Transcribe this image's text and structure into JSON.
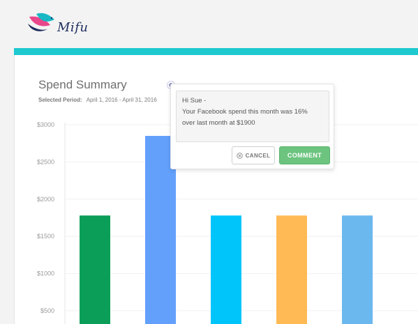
{
  "header": {
    "logo_text": "Mifu",
    "accent_color": "#1ec9cf"
  },
  "summary": {
    "title": "Spend Summary",
    "period_label": "Selected Period:",
    "period_value": "April 1, 2016 - April 31, 2016"
  },
  "chart_data": {
    "type": "bar",
    "categories": [
      "",
      "",
      "",
      "",
      ""
    ],
    "values": [
      1780,
      2850,
      1780,
      1780,
      1780
    ],
    "colors": [
      "#0a9e58",
      "#62a0fb",
      "#00c5fb",
      "#ffba55",
      "#6bb8ee"
    ],
    "yticks": [
      "$500",
      "$1000",
      "$1500",
      "$2000",
      "$2500",
      "$3000"
    ],
    "ytick_values": [
      500,
      1000,
      1500,
      2000,
      2500,
      3000
    ],
    "ylim": [
      0,
      3000
    ],
    "grid": true
  },
  "comment": {
    "lines": [
      "Hi Sue -",
      "Your Facebook spend this month was 16%",
      "over last month at $1900"
    ],
    "cancel_label": "CANCEL",
    "submit_label": "COMMENT"
  }
}
